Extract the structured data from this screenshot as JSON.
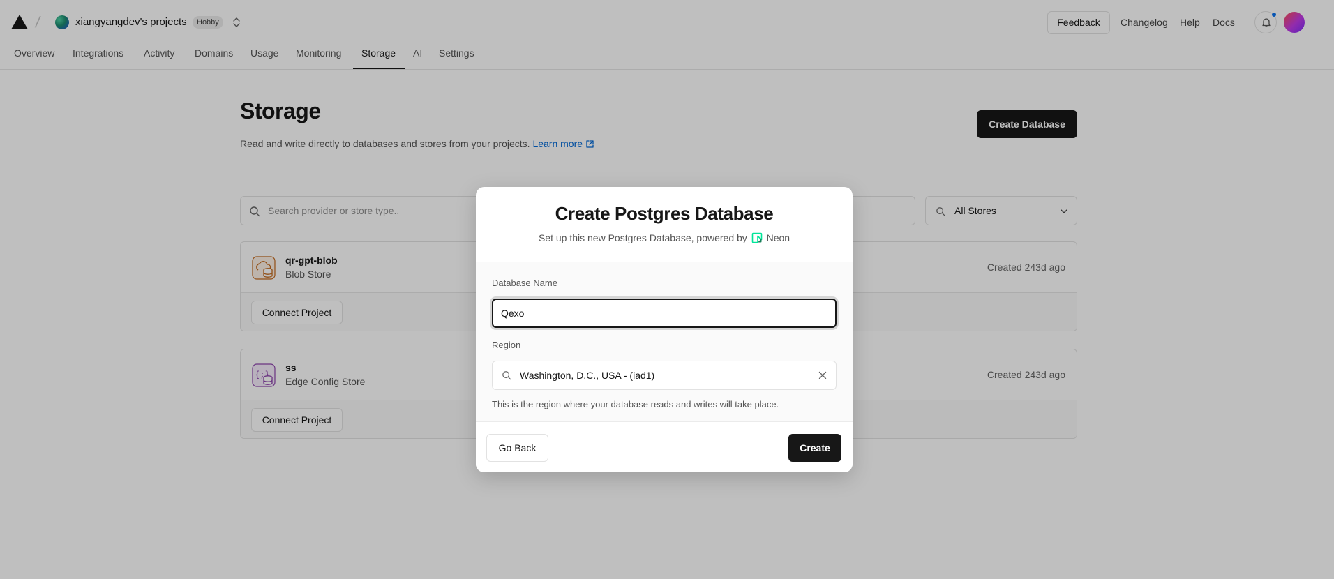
{
  "header": {
    "project_name": "xiangyangdev's projects",
    "plan_badge": "Hobby",
    "feedback_label": "Feedback",
    "links": [
      "Changelog",
      "Help",
      "Docs"
    ]
  },
  "nav": {
    "tabs": [
      "Overview",
      "Integrations",
      "Activity",
      "Domains",
      "Usage",
      "Monitoring",
      "Storage",
      "AI",
      "Settings"
    ],
    "active": "Storage"
  },
  "page": {
    "title": "Storage",
    "description": "Read and write directly to databases and stores from your projects.",
    "learn_more": "Learn more",
    "create_button": "Create Database",
    "search_placeholder": "Search provider or store type..",
    "filter_value": "All Stores"
  },
  "stores": [
    {
      "name": "qr-gpt-blob",
      "type": "Blob Store",
      "created": "Created 243d ago",
      "connect_label": "Connect Project",
      "icon": "blob-store-icon"
    },
    {
      "name": "ss",
      "type": "Edge Config Store",
      "created": "Created 243d ago",
      "connect_label": "Connect Project",
      "icon": "edge-config-icon"
    }
  ],
  "modal": {
    "title": "Create Postgres Database",
    "subtitle": "Set up this new Postgres Database, powered by",
    "provider": "Neon",
    "name_label": "Database Name",
    "name_value": "Qexo",
    "region_label": "Region",
    "region_value": "Washington, D.C., USA - (iad1)",
    "help_text": "This is the region where your database reads and writes will take place.",
    "back_label": "Go Back",
    "create_label": "Create"
  },
  "colors": {
    "accent_blue": "#0068d6",
    "primary_black": "#171717",
    "neon_green": "#00e599",
    "blob_orange": "#c2691d",
    "edge_purple": "#8e44ad"
  }
}
